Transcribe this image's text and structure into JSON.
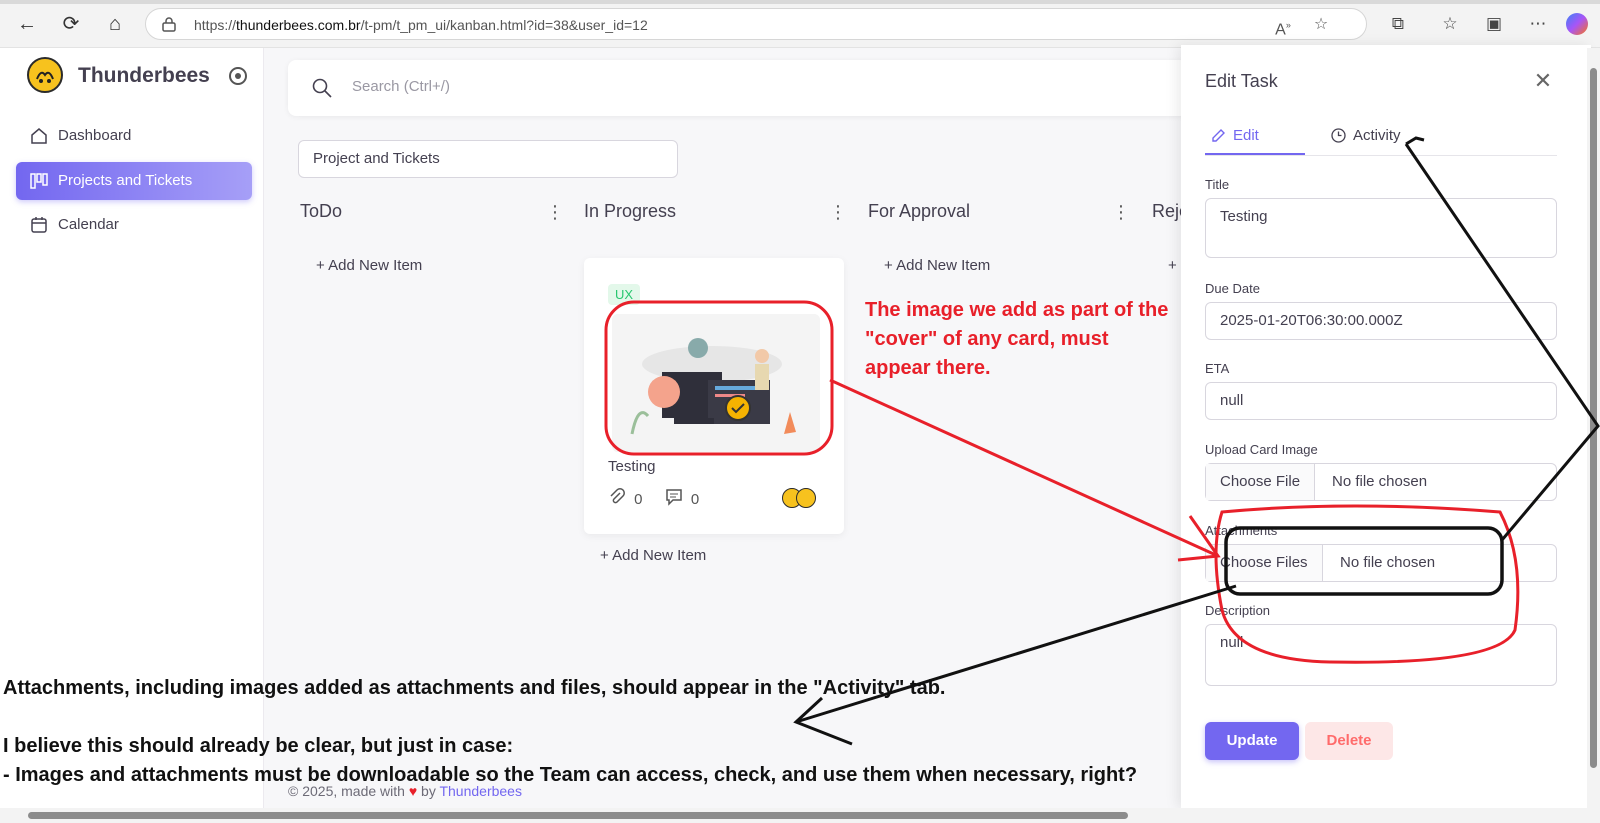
{
  "browser": {
    "url_prefix": "https://",
    "url_domain": "thunderbees.com.br",
    "url_path": "/t-pm/t_pm_ui/kanban.html?id=38&user_id=12"
  },
  "sidebar": {
    "brand": "Thunderbees",
    "items": [
      {
        "label": "Dashboard"
      },
      {
        "label": "Projects and Tickets"
      },
      {
        "label": "Calendar"
      }
    ]
  },
  "search": {
    "placeholder": "Search (Ctrl+/)"
  },
  "project_selector": {
    "value": "Project and Tickets"
  },
  "board": {
    "columns": [
      {
        "title": "ToDo",
        "add_label": "+ Add New Item"
      },
      {
        "title": "In Progress",
        "add_label": "+ Add New Item"
      },
      {
        "title": "For Approval",
        "add_label": "+ Add New Item"
      },
      {
        "title": "Reje",
        "add_label": "+"
      }
    ],
    "card": {
      "badge": "UX",
      "title": "Testing",
      "attachments": "0",
      "comments": "0"
    }
  },
  "edit_panel": {
    "title": "Edit Task",
    "tabs": {
      "edit": "Edit",
      "activity": "Activity"
    },
    "fields": {
      "title_label": "Title",
      "title_value": "Testing",
      "due_label": "Due Date",
      "due_value": "2025-01-20T06:30:00.000Z",
      "eta_label": "ETA",
      "eta_value": "null",
      "upload_label": "Upload Card Image",
      "upload_button": "Choose File",
      "upload_status": "No file chosen",
      "attachments_label": "Attachments",
      "attachments_button": "Choose Files",
      "attachments_status": "No file chosen",
      "description_label": "Description",
      "description_value": "null"
    },
    "update_label": "Update",
    "delete_label": "Delete"
  },
  "footer": {
    "text": "© 2025, made with",
    "by": "by",
    "link": "Thunderbees"
  },
  "annotations": {
    "red_note": "The image we add as part of the \"cover\" of any card, must appear there.",
    "black_line1": "Attachments, including images added as attachments and files, should appear in the \"Activity\" tab.",
    "black_line2": "I believe this should already be clear, but just in case:",
    "black_line3": "- Images and attachments must be downloadable so the Team can access, check, and use them when necessary, right?"
  },
  "colors": {
    "accent": "#7367f0",
    "badge_green": "#28c76f",
    "annotation_red": "#e8202a",
    "danger": "#ff6b6b"
  }
}
